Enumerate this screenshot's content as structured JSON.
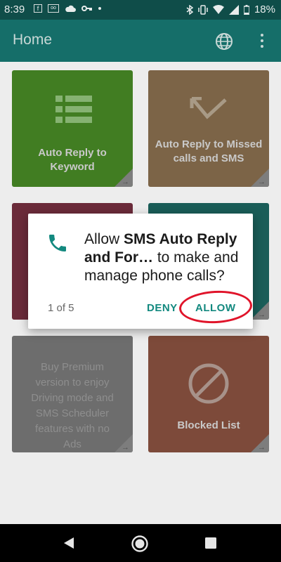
{
  "status_bar": {
    "time": "8:39",
    "battery": "18%",
    "left_icons": [
      "facebook-icon",
      "voicemail-icon",
      "cloud-icon",
      "key-icon",
      "dot-icon"
    ],
    "right_icons": [
      "bluetooth-icon",
      "vibrate-icon",
      "wifi-icon",
      "signal-icon",
      "battery-icon"
    ]
  },
  "app_bar": {
    "title": "Home",
    "actions": [
      "globe-icon",
      "more-vert-icon"
    ]
  },
  "tiles": [
    {
      "label": "Auto Reply to Keyword",
      "icon": "list-icon",
      "color": "#417d22"
    },
    {
      "label": "Auto Reply to Missed calls and SMS",
      "icon": "missed-call-icon",
      "color": "#7c6447"
    },
    {
      "label": "",
      "color": "#6b2b3a"
    },
    {
      "label": "",
      "color": "#1a5d58"
    },
    {
      "promo": "Buy Premium version to enjoy Driving mode and SMS Scheduler features with no Ads",
      "color": "#6d6d6d"
    },
    {
      "label": "Blocked List",
      "icon": "block-icon",
      "color": "#7d4a3a"
    }
  ],
  "dialog": {
    "message_prefix": "Allow ",
    "app_name": "SMS Auto Reply and For…",
    "message_suffix": " to make and manage phone calls?",
    "counter": "1 of 5",
    "deny_label": "DENY",
    "allow_label": "ALLOW",
    "icon": "phone-icon",
    "accent_color": "#13897f"
  },
  "nav_bar": {
    "buttons": [
      "back-icon",
      "home-icon",
      "recents-icon"
    ]
  }
}
